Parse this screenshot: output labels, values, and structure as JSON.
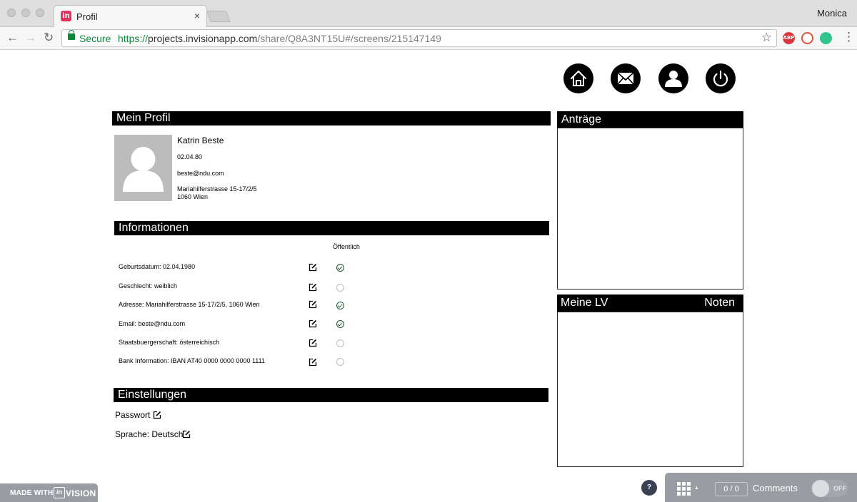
{
  "browser": {
    "tab_title": "Profil",
    "tab_close": "×",
    "profile_name": "Monica",
    "secure_label": "Secure",
    "url_scheme": "https://",
    "url_host": "projects.invisionapp.com",
    "url_path": "/share/Q8A3NT15U#/screens/215147149",
    "extensions": [
      "adblock-plus-icon",
      "opera-icon",
      "chat-bubble-icon"
    ]
  },
  "nav": {
    "icons": [
      "home-icon",
      "mail-icon",
      "user-icon",
      "power-icon"
    ]
  },
  "profile": {
    "section_title": "Mein Profil",
    "name": "Katrin Beste",
    "birthdate": "02.04.80",
    "email": "beste@ndu.com",
    "address_line1": "Mariahilferstrasse 15-17/2/5",
    "address_line2": "1060 Wien"
  },
  "info": {
    "section_title": "Informationen",
    "public_header": "Öffentlich",
    "rows": [
      {
        "label": "Geburtsdatum: 02.04.1980",
        "public": true
      },
      {
        "label": "Geschlecht: weiblich",
        "public": false
      },
      {
        "label": "Adresse: Mariahilferstrasse 15-17/2/5, 1060 Wien",
        "public": true
      },
      {
        "label": "Email: beste@ndu.com",
        "public": true
      },
      {
        "label": "Staatsbuergerschaft: österreichisch",
        "public": false
      },
      {
        "label": "Bank Information: IBAN AT40 0000 0000 0000 1111",
        "public": false
      }
    ]
  },
  "settings": {
    "section_title": "Einstellungen",
    "password_label": "Passwort",
    "language_label": "Sprache: Deutsch"
  },
  "antraege": {
    "title": "Anträge"
  },
  "meine_lv": {
    "title": "Meine LV",
    "grades_label": "Noten"
  },
  "invision": {
    "made_with": "MADE WITH",
    "logo_letters": "in",
    "vision": "VISION",
    "help": "?",
    "counter_left": "0",
    "counter_right": "0",
    "comments": "Comments",
    "toggle": "OFF"
  }
}
